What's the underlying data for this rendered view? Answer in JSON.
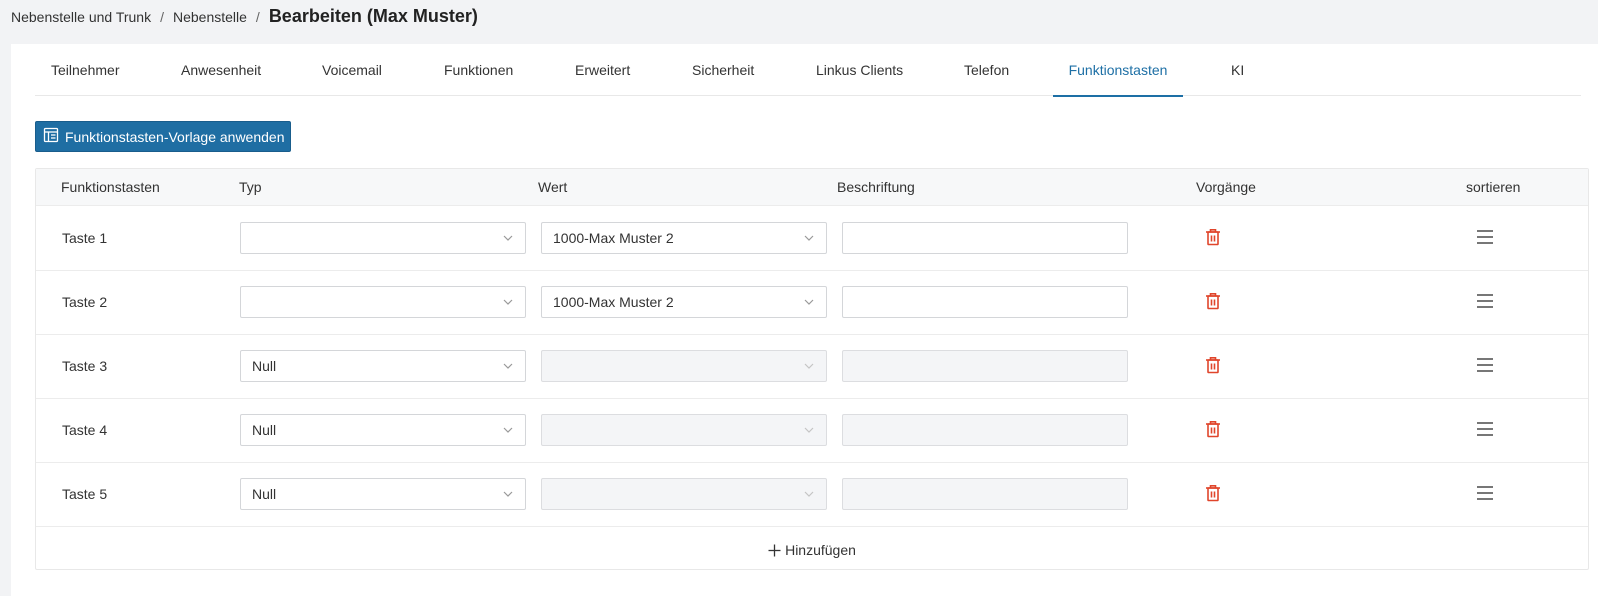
{
  "breadcrumb": {
    "item1": "Nebenstelle und Trunk",
    "item2": "Nebenstelle",
    "sep": "/",
    "current": "Bearbeiten (Max Muster)"
  },
  "tabs": [
    {
      "label": "Teilnehmer"
    },
    {
      "label": "Anwesenheit"
    },
    {
      "label": "Voicemail"
    },
    {
      "label": "Funktionen"
    },
    {
      "label": "Erweitert"
    },
    {
      "label": "Sicherheit"
    },
    {
      "label": "Linkus Clients"
    },
    {
      "label": "Telefon"
    },
    {
      "label": "Funktionstasten",
      "active": true
    },
    {
      "label": "KI"
    }
  ],
  "apply_button": {
    "label": "Funktionstasten-Vorlage anwenden",
    "icon": "template-icon"
  },
  "table": {
    "headers": {
      "key": "Funktionstasten",
      "type": "Typ",
      "value": "Wert",
      "label": "Beschriftung",
      "actions": "Vorgänge",
      "sort": "sortieren"
    },
    "rows": [
      {
        "key": "Taste 1",
        "type": "",
        "value": "1000-Max Muster 2",
        "label": "",
        "disabled": false
      },
      {
        "key": "Taste 2",
        "type": "",
        "value": "1000-Max Muster 2",
        "label": "",
        "disabled": false
      },
      {
        "key": "Taste 3",
        "type": "Null",
        "value": "",
        "label": "",
        "disabled": true
      },
      {
        "key": "Taste 4",
        "type": "Null",
        "value": "",
        "label": "",
        "disabled": true
      },
      {
        "key": "Taste 5",
        "type": "Null",
        "value": "",
        "label": "",
        "disabled": true
      }
    ],
    "add_label": "Hinzufügen"
  },
  "colors": {
    "accent": "#1f6ea3",
    "danger": "#e0452b"
  }
}
